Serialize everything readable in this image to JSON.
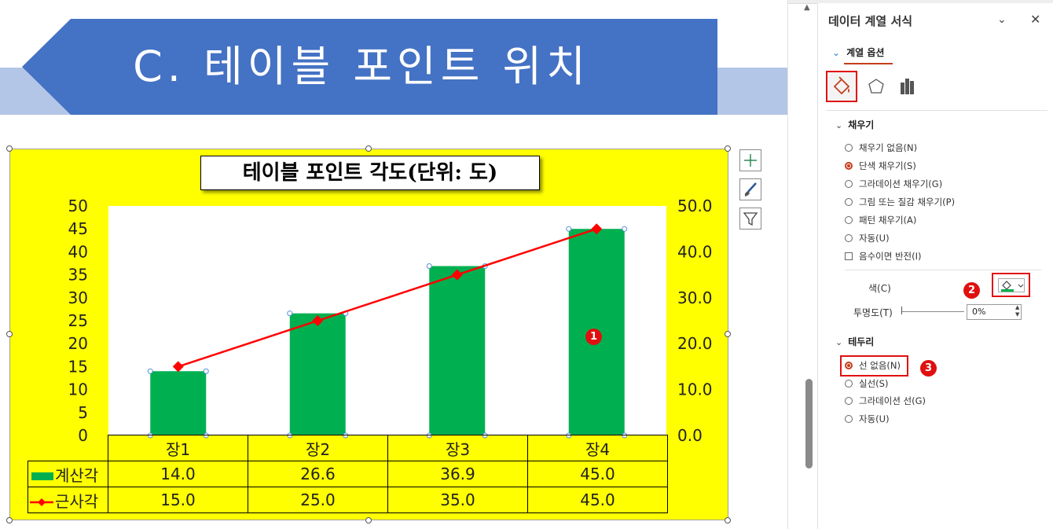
{
  "slide": {
    "title": "C. 테이블 포인트 위치"
  },
  "chart_data": {
    "type": "bar",
    "title": "테이블 포인트 각도(단위: 도)",
    "categories": [
      "장1",
      "장2",
      "장3",
      "장4"
    ],
    "series": [
      {
        "name": "계산각",
        "type": "bar",
        "color": "#00b050",
        "values": [
          14.0,
          26.6,
          36.9,
          45.0
        ],
        "labels": [
          "14.0",
          "26.6",
          "36.9",
          "45.0"
        ]
      },
      {
        "name": "근사각",
        "type": "line",
        "color": "#ff0000",
        "marker": "diamond",
        "values": [
          15.0,
          25.0,
          35.0,
          45.0
        ],
        "labels": [
          "15.0",
          "25.0",
          "35.0",
          "45.0"
        ]
      }
    ],
    "y_left": {
      "ylim": [
        0,
        50
      ],
      "ticks": [
        "0",
        "5",
        "10",
        "15",
        "20",
        "25",
        "30",
        "35",
        "40",
        "45",
        "50"
      ]
    },
    "y_right": {
      "ylim": [
        0,
        50
      ],
      "ticks": [
        "0.0",
        "10.0",
        "20.0",
        "30.0",
        "40.0",
        "50.0"
      ]
    },
    "data_table": true,
    "background": "#ffff00",
    "plot_background": "#ffffff"
  },
  "annotations": {
    "callout_1": "1",
    "callout_2": "2",
    "callout_3": "3"
  },
  "pane": {
    "title": "데이터 계열 서식",
    "section_tab": "계열 옵션",
    "fill": {
      "heading": "채우기",
      "options": [
        "채우기 없음(N)",
        "단색 채우기(S)",
        "그라데이션 채우기(G)",
        "그림 또는 질감 채우기(P)",
        "패턴 채우기(A)",
        "자동(U)"
      ],
      "selected": "단색 채우기(S)",
      "invert_label": "음수이면 반전(I)",
      "color_label": "색(C)",
      "color_value": "#00b050",
      "transparency_label": "투명도(T)",
      "transparency_value": "0%"
    },
    "border": {
      "heading": "테두리",
      "options": [
        "선 없음(N)",
        "실선(S)",
        "그라데이션 선(G)",
        "자동(U)"
      ],
      "selected": "선 없음(N)"
    }
  }
}
